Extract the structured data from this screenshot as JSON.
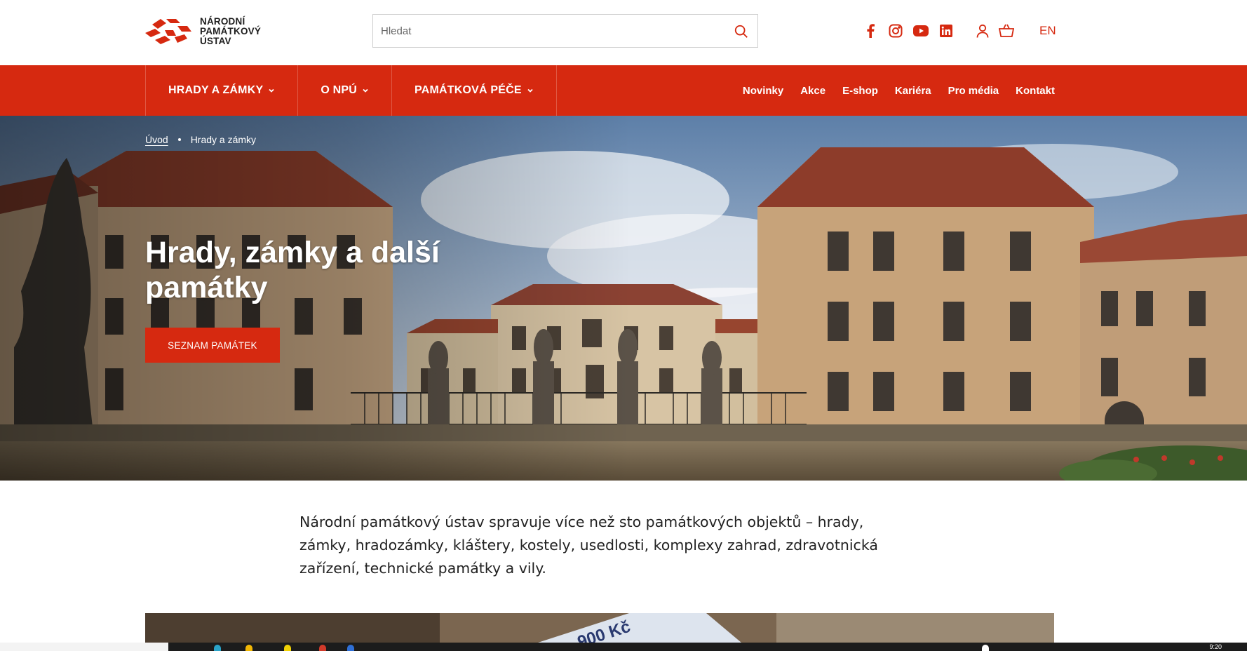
{
  "header": {
    "logo_lines": [
      "NÁRODNÍ",
      "PAMÁTKOVÝ",
      "ÚSTAV"
    ],
    "search_placeholder": "Hledat",
    "social_icons": [
      "facebook-icon",
      "instagram-icon",
      "youtube-icon",
      "linkedin-icon"
    ],
    "user_icons": [
      "user-icon",
      "basket-icon"
    ],
    "lang": "EN"
  },
  "nav": {
    "main": [
      {
        "label": "HRADY A ZÁMKY"
      },
      {
        "label": "O NPÚ"
      },
      {
        "label": "PAMÁTKOVÁ PÉČE"
      }
    ],
    "secondary": [
      {
        "label": "Novinky"
      },
      {
        "label": "Akce"
      },
      {
        "label": "E-shop"
      },
      {
        "label": "Kariéra"
      },
      {
        "label": "Pro média"
      },
      {
        "label": "Kontakt"
      }
    ]
  },
  "hero": {
    "breadcrumb": {
      "home": "Úvod",
      "current": "Hrady a zámky"
    },
    "title": "Hrady, zámky a další památky",
    "button": "SEZNAM PAMÁTEK"
  },
  "intro": {
    "text": "Národní památkový ústav spravuje více než sto památkových objektů – hrady, zámky, hradozámky, kláštery, kostely, usedlosti, komplexy zahrad, zdravotnická zařízení, technické památky a vily."
  },
  "strip": {
    "partial_text": "900 Kč"
  },
  "taskbar": {
    "clock": "9:20"
  },
  "colors": {
    "brand_red": "#d62910",
    "text_dark": "#222222"
  }
}
